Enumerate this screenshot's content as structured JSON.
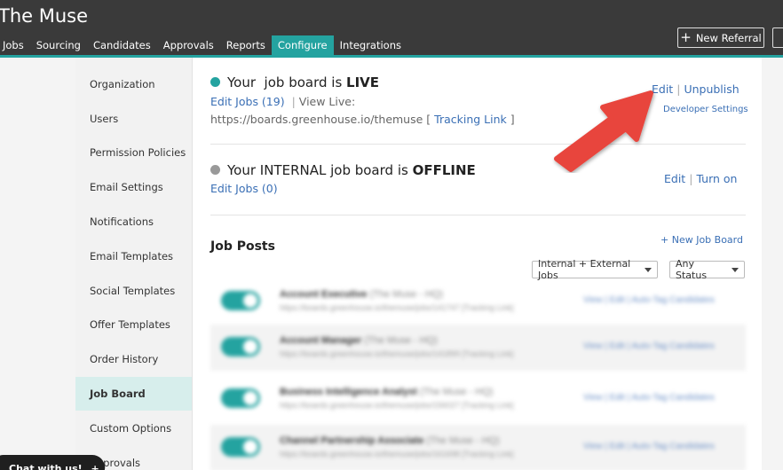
{
  "app": {
    "title": "The Muse",
    "new_referral_label": "New Referral"
  },
  "nav": [
    {
      "label": "Jobs"
    },
    {
      "label": "Sourcing"
    },
    {
      "label": "Candidates"
    },
    {
      "label": "Approvals"
    },
    {
      "label": "Reports"
    },
    {
      "label": "Configure",
      "active": true
    },
    {
      "label": "Integrations"
    }
  ],
  "sidebar": {
    "items": [
      {
        "label": "Organization"
      },
      {
        "label": "Users"
      },
      {
        "label": "Permission Policies"
      },
      {
        "label": "Email Settings"
      },
      {
        "label": "Notifications"
      },
      {
        "label": "Email Templates"
      },
      {
        "label": "Social Templates"
      },
      {
        "label": "Offer Templates"
      },
      {
        "label": "Order History"
      },
      {
        "label": "Job Board",
        "active": true
      },
      {
        "label": "Custom Options"
      },
      {
        "label": "Approvals"
      }
    ]
  },
  "public_board": {
    "status_prefix": "Your  job board is",
    "status": "LIVE",
    "edit_jobs": "Edit Jobs (19)",
    "view_live_label": "View Live:",
    "url": "https://boards.greenhouse.io/themuse",
    "bracket_open": "[",
    "tracking_link": "Tracking Link",
    "bracket_close": "]",
    "edit": "Edit",
    "unpublish": "Unpublish",
    "developer_settings": "Developer Settings"
  },
  "internal_board": {
    "status_prefix": "Your INTERNAL job board is",
    "status": "OFFLINE",
    "edit_jobs": "Edit Jobs (0)",
    "edit": "Edit",
    "turn_on": "Turn on"
  },
  "job_posts": {
    "title": "Job Posts",
    "new_board_label": "+ New Job Board",
    "filter_type": "Internal + External Jobs",
    "filter_status": "Any Status",
    "rows": [
      {
        "title": "Account Executive",
        "company": "(The Muse - HQ)",
        "url": "https://boards.greenhouse.io/themuse/jobs/141747",
        "tracking": "[Tracking Link]",
        "actions": "View | Edit | Auto-Tag Candidates"
      },
      {
        "title": "Account Manager",
        "company": "(The Muse - HQ)",
        "url": "https://boards.greenhouse.io/themuse/jobs/141899",
        "tracking": "[Tracking Link]",
        "actions": "View | Edit | Auto-Tag Candidates"
      },
      {
        "title": "Business Intelligence Analyst",
        "company": "(The Muse - HQ)",
        "url": "https://boards.greenhouse.io/themuse/jobs/156027",
        "tracking": "[Tracking Link]",
        "actions": "View | Edit | Auto-Tag Candidates"
      },
      {
        "title": "Channel Partnership Associate",
        "company": "(The Muse - HQ)",
        "url": "https://boards.greenhouse.io/themuse/jobs/161698",
        "tracking": "[Tracking Link]",
        "actions": "View | Edit | Auto-Tag Candidates"
      }
    ]
  },
  "chat": {
    "label": "Chat with us!",
    "icon": "plus-icon"
  },
  "colors": {
    "accent": "#24a3a0",
    "header": "#3a3a3a",
    "link": "#3a6fb5",
    "arrow": "#e8453c"
  }
}
